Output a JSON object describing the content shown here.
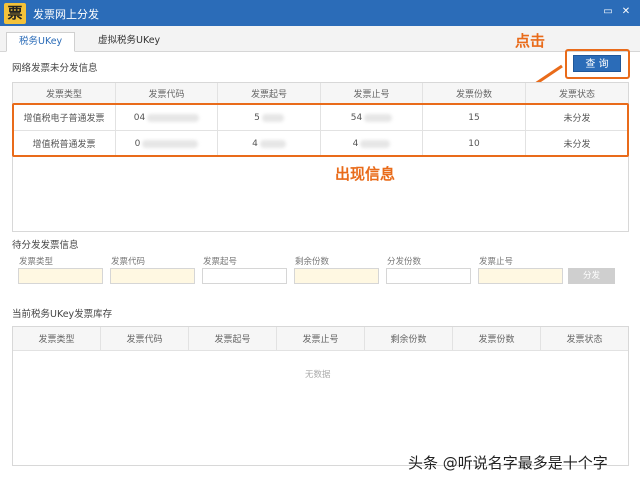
{
  "app": {
    "logo": "票",
    "title": "发票网上分发",
    "min_icon": "▭",
    "close_icon": "✕"
  },
  "tabs": [
    {
      "label": "税务UKey",
      "active": true
    },
    {
      "label": "虚拟税务UKey",
      "active": false
    }
  ],
  "network_section": {
    "title": "网络发票未分发信息",
    "query_label": "查 询",
    "annotation_click": "点击",
    "annotation_info": "出现信息",
    "headers": [
      "发票类型",
      "发票代码",
      "发票起号",
      "发票止号",
      "发票份数",
      "发票状态"
    ],
    "rows": [
      [
        "增值税电子普通发票",
        "04",
        "5",
        "54",
        "15",
        "未分发"
      ],
      [
        "增值税普通发票",
        "0",
        "4",
        "4",
        "10",
        "未分发"
      ]
    ]
  },
  "pending_section": {
    "title": "待分发发票信息",
    "fields": [
      "发票类型",
      "发票代码",
      "发票起号",
      "剩余份数",
      "分发份数",
      "发票止号"
    ],
    "distribute_label": "分发"
  },
  "inventory_section": {
    "title": "当前税务UKey发票库存",
    "headers": [
      "发票类型",
      "发票代码",
      "发票起号",
      "发票止号",
      "剩余份数",
      "发票份数",
      "发票状态"
    ],
    "empty_text": "无数据"
  },
  "watermark": "头条 @听说名字最多是十个字",
  "accent_color": "#e96b1a",
  "brand_color": "#2b6cb8"
}
